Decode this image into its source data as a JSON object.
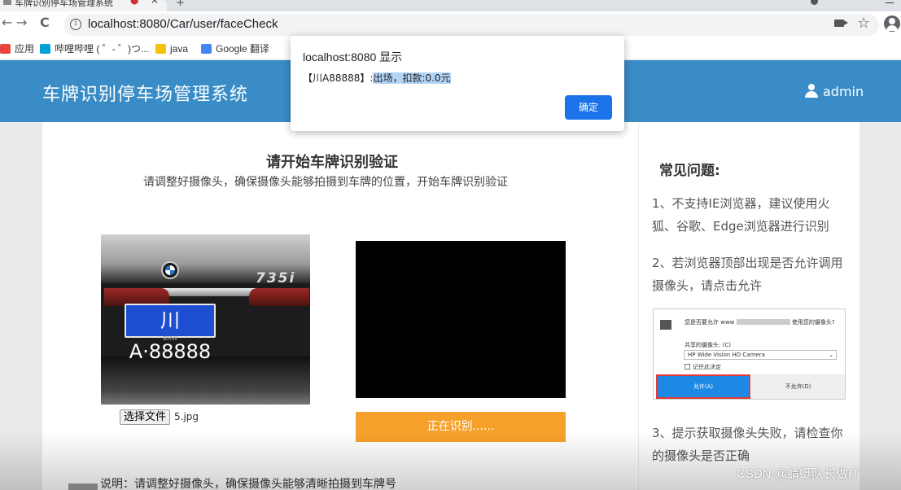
{
  "browser": {
    "tab_title": "车牌识别停车场管理系统",
    "new_tab": "+",
    "url": "localhost:8080/Car/user/faceCheck",
    "nav": {
      "back": "←",
      "forward": "→",
      "reload": "C"
    }
  },
  "bookmarks": [
    {
      "label": "应用",
      "icon": "apps-icon",
      "color": "#e8453c"
    },
    {
      "label": "哔哩哔哩 ( ゜- ゜)つ...",
      "icon": "bilibili-icon",
      "color": "#00a1d6"
    },
    {
      "label": "java",
      "icon": "folder-icon",
      "color": "#f4c20d"
    },
    {
      "label": "Google 翻译",
      "icon": "google-translate-icon",
      "color": "#4285f4"
    }
  ],
  "header": {
    "title": "车牌识别停车场管理系统",
    "user": "admin",
    "bg_color": "#3a8cc6"
  },
  "main": {
    "title": "请开始车牌识别验证",
    "subtitle": "请调整好摄像头，确保摄像头能够拍摄到车牌的位置，开始车牌识别验证",
    "plate_text": "川A·88888",
    "badge": "735i",
    "plate_brand": "BMW",
    "file_button": "选择文件",
    "file_name": "5.jpg",
    "recognize_button": "正在识别......",
    "description": "说明：请调整好摄像头，确保摄像头能够清晰拍摄到车牌号"
  },
  "faq": {
    "title": "常见问题:",
    "items": [
      "1、不支持IE浏览器，建议使用火狐、谷歌、Edge浏览器进行识别",
      "2、若浏览器顶部出现是否允许调用摄像头，请点击允许",
      "3、提示获取摄像头失败，请检查你的摄像头是否正确"
    ],
    "permission": {
      "question_prefix": "您是否要允许 www",
      "question_suffix": "使用您的摄像头?",
      "share_label": "共享的摄像头: (C)",
      "camera": "HP Wide Vision HD Camera",
      "remember": "记住此决定",
      "allow": "允许(A)",
      "deny": "不允许(D)"
    }
  },
  "dialog": {
    "title": "localhost:8080 显示",
    "message_prefix": "【川A88888】:",
    "message_selected": "出场，扣款:0.0元",
    "ok": "确定"
  },
  "watermark": "CSDN @蜻蜓队长做IT"
}
